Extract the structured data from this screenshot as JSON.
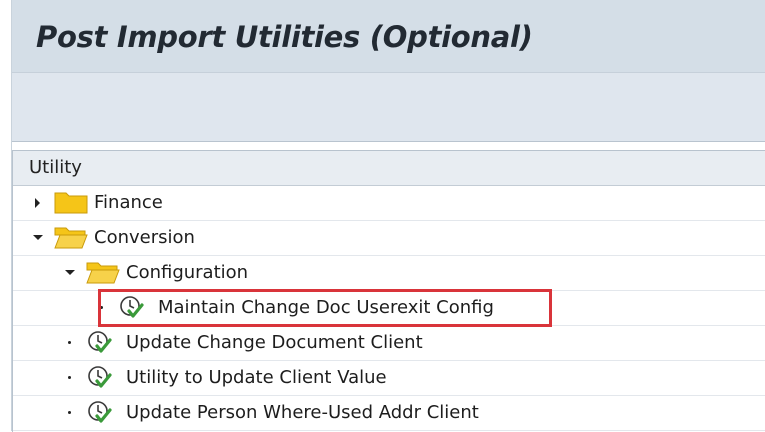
{
  "window": {
    "title": "Post Import Utilities (Optional)"
  },
  "tree": {
    "column_header": "Utility",
    "nodes": [
      {
        "label": "Finance",
        "icon": "folder-closed-icon",
        "expander": "collapsed"
      },
      {
        "label": "Conversion",
        "icon": "folder-open-icon",
        "expander": "expanded"
      },
      {
        "label": "Configuration",
        "icon": "folder-open-icon",
        "expander": "expanded"
      },
      {
        "label": "Maintain Change Doc Userexit Config",
        "icon": "execute-clock-icon",
        "expander": "leaf",
        "highlighted": true
      },
      {
        "label": "Update Change Document Client",
        "icon": "execute-clock-icon",
        "expander": "leaf"
      },
      {
        "label": "Utility to Update Client Value",
        "icon": "execute-clock-icon",
        "expander": "leaf"
      },
      {
        "label": "Update Person Where-Used Addr Client",
        "icon": "execute-clock-icon",
        "expander": "leaf"
      }
    ]
  },
  "colors": {
    "title_bar": "#d4dee7",
    "toolbar": "#dfe6ee",
    "folder": "#f5c518",
    "highlight": "#d9343a",
    "execute_icon_green": "#3a9a3a"
  }
}
